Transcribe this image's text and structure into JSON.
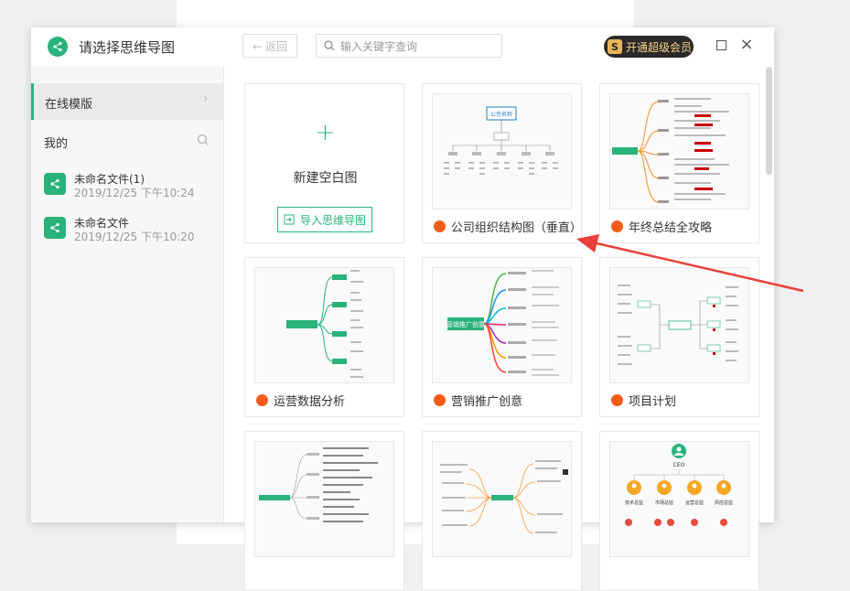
{
  "window": {
    "title": "请选择思维导图",
    "back_label": "← 返回",
    "search_placeholder": "输入关键字查询",
    "vip_badge": "S",
    "vip_label": "开通超级会员"
  },
  "sidebar": {
    "online_label": "在线模版",
    "mine_label": "我的",
    "files": [
      {
        "name": "未命名文件(1)",
        "date": "2019/12/25 下午10:24"
      },
      {
        "name": "未命名文件",
        "date": "2019/12/25 下午10:20"
      }
    ]
  },
  "grid": {
    "new_card": {
      "label": "新建空白图",
      "import_label": "导入思维导图"
    },
    "templates": [
      {
        "name": "公司组织结构图（垂直）",
        "thumb_text": "公司名称"
      },
      {
        "name": "年终总结全攻略"
      },
      {
        "name": "运营数据分析"
      },
      {
        "name": "营销推广创意",
        "thumb_text": "营销推广创意"
      },
      {
        "name": "项目计划"
      },
      {
        "name": ""
      },
      {
        "name": ""
      },
      {
        "name": "",
        "thumb_text": "CEO",
        "depts": [
          "技术总监",
          "市场总监",
          "运营总监",
          "风控总监"
        ]
      }
    ]
  },
  "colors": {
    "accent": "#2ab27b",
    "hot": "#f25c19",
    "arrow": "#e8403a"
  }
}
